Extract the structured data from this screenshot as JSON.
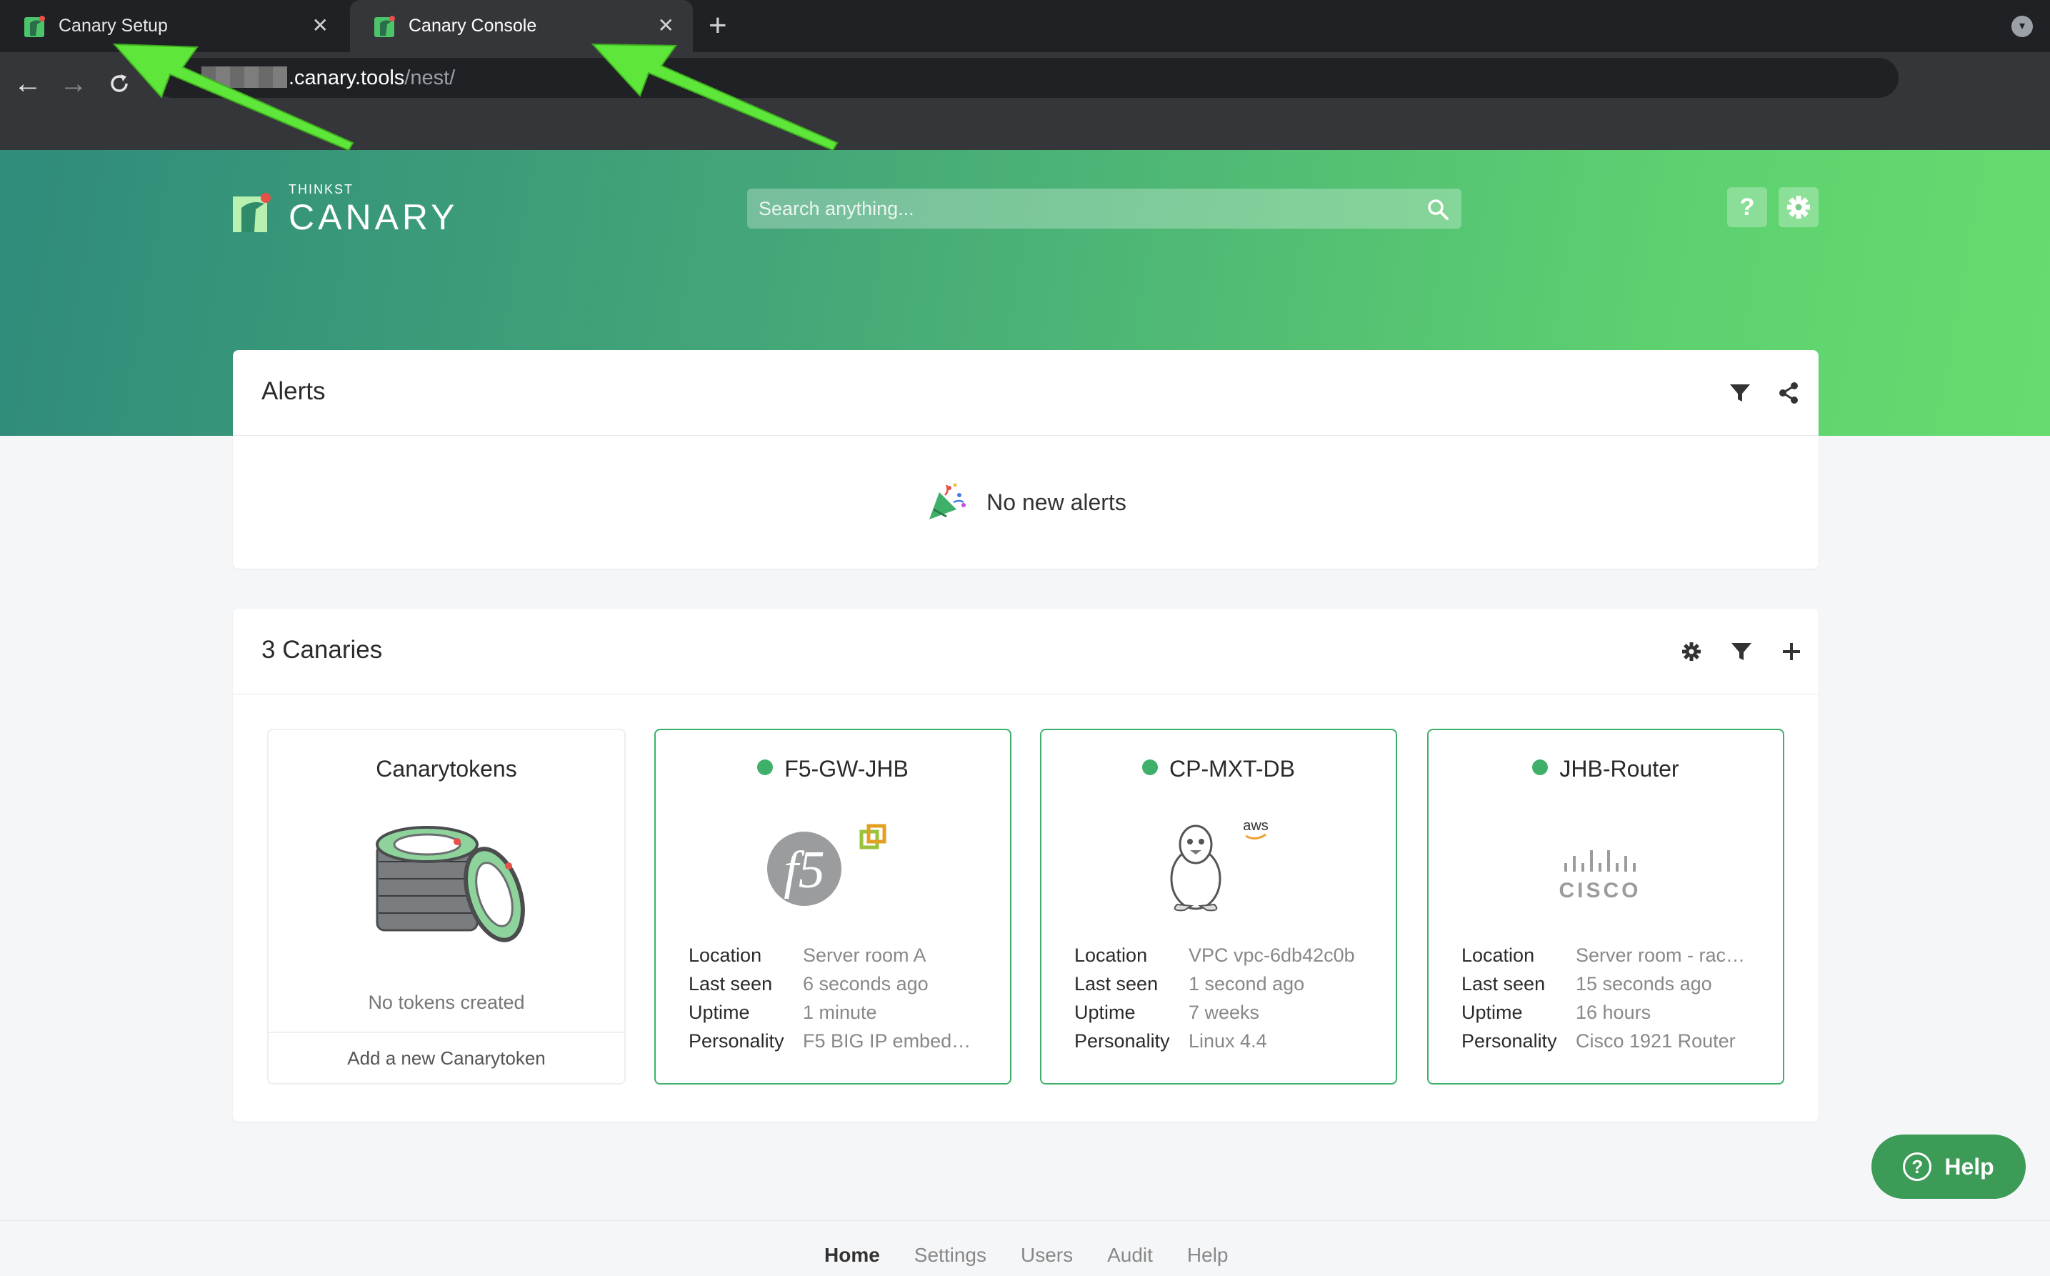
{
  "browser": {
    "tabs": [
      {
        "title": "Canary Setup",
        "active": false
      },
      {
        "title": "Canary Console",
        "active": true
      }
    ],
    "url_host": ".canary.tools",
    "url_path": "/nest/",
    "icons": {
      "back": "arrow-left-icon",
      "forward": "arrow-right-icon",
      "reload": "reload-icon",
      "new_tab": "plus-icon",
      "tab_close": "close-icon"
    }
  },
  "header": {
    "logo_small": "THINKST",
    "logo_big": "CANARY",
    "search_placeholder": "Search anything...",
    "help_label": "?",
    "colors": {
      "gradient_start": "#2f8b7a",
      "gradient_end": "#66dc6e"
    }
  },
  "alerts": {
    "title": "Alerts",
    "empty_message": "No new alerts"
  },
  "canaries": {
    "title": "3 Canaries",
    "tokens": {
      "title": "Canarytokens",
      "empty": "No tokens created",
      "add_label": "Add a new Canarytoken"
    },
    "labels": {
      "location": "Location",
      "last_seen": "Last seen",
      "uptime": "Uptime",
      "personality": "Personality"
    },
    "devices": [
      {
        "name": "F5-GW-JHB",
        "location": "Server room A",
        "last_seen": "6 seconds ago",
        "uptime": "1 minute",
        "personality": "F5 BIG IP embed…",
        "status_color": "#3fb06a",
        "logo": "f5-logo"
      },
      {
        "name": "CP-MXT-DB",
        "location": "VPC vpc-6db42c0b",
        "last_seen": "1 second ago",
        "uptime": "7 weeks",
        "personality": "Linux 4.4",
        "status_color": "#3fb06a",
        "logo": "linux-tux-logo",
        "badge": "aws"
      },
      {
        "name": "JHB-Router",
        "location": "Server room - rac…",
        "last_seen": "15 seconds ago",
        "uptime": "16 hours",
        "personality": "Cisco 1921 Router",
        "status_color": "#3fb06a",
        "logo": "cisco-logo",
        "logo_text": "CISCO"
      }
    ]
  },
  "help_fab": {
    "label": "Help",
    "icon_glyph": "?"
  },
  "footer": {
    "links": [
      "Home",
      "Settings",
      "Users",
      "Audit",
      "Help"
    ],
    "active": "Home"
  }
}
